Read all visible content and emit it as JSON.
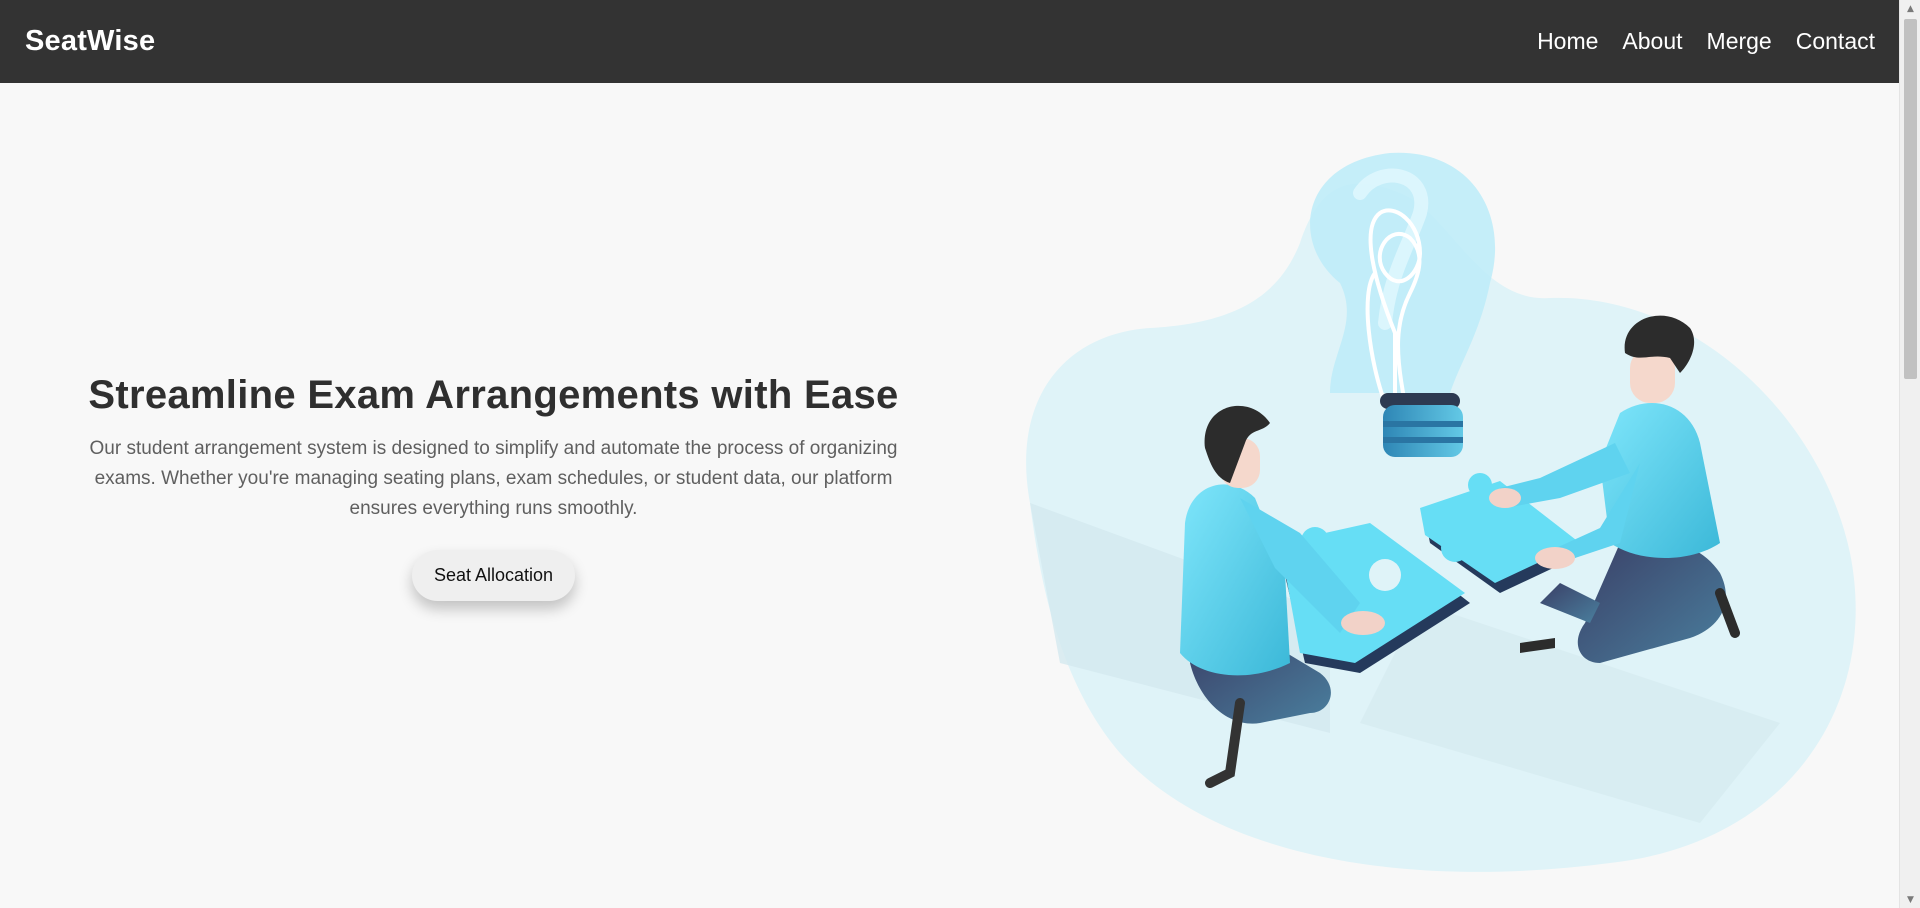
{
  "navbar": {
    "brand": "SeatWise",
    "links": [
      {
        "label": "Home"
      },
      {
        "label": "About"
      },
      {
        "label": "Merge"
      },
      {
        "label": "Contact"
      }
    ]
  },
  "hero": {
    "title": "Streamline Exam Arrangements with Ease",
    "description": "Our student arrangement system is designed to simplify and automate the process of organizing exams. Whether you're managing seating plans, exam schedules, or student data, our platform ensures everything runs smoothly.",
    "button_label": "Seat Allocation"
  },
  "illustration": {
    "subject": "two people fitting puzzle pieces together under a light bulb",
    "icons": [
      "light-bulb-icon",
      "puzzle-piece-icon",
      "person-figure-icon"
    ]
  },
  "colors": {
    "navbar_bg": "#333333",
    "page_bg": "#f8f8f8",
    "accent_cyan": "#5fd3ef",
    "blob_bg": "#dff3f8",
    "button_bg": "#efefef"
  },
  "scrollbar": {
    "scroll_position": 0
  }
}
